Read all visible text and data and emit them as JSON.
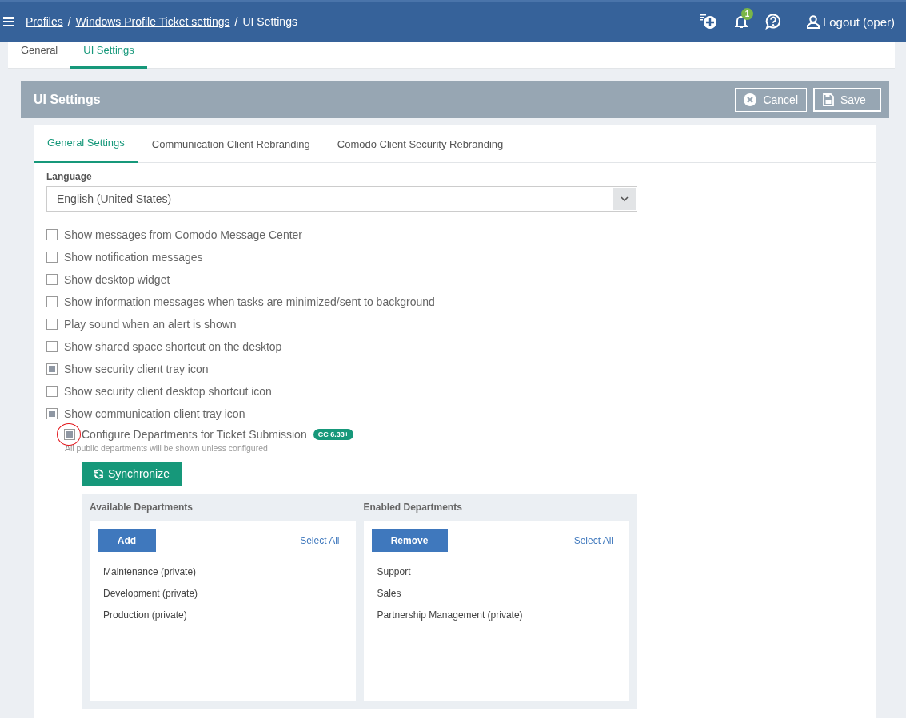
{
  "header": {
    "separator": "/",
    "breadcrumbs": [
      {
        "label": "Profiles",
        "link": true
      },
      {
        "label": "Windows Profile Ticket settings",
        "link": true
      },
      {
        "label": "UI Settings",
        "link": false
      }
    ],
    "notification_count": "1",
    "user": "Logout (oper)"
  },
  "page_tabs": [
    {
      "label": "General",
      "selected": false
    },
    {
      "label": "UI Settings",
      "selected": true
    }
  ],
  "panel": {
    "title": "UI Settings",
    "buttons": [
      {
        "label": "Cancel",
        "kind": "cancel"
      },
      {
        "label": "Save",
        "kind": "save"
      }
    ]
  },
  "tabs": [
    {
      "label": "General Settings",
      "selected": true
    },
    {
      "label": "Communication Client Rebranding",
      "selected": false
    },
    {
      "label": "Comodo Client Security Rebranding",
      "selected": false
    }
  ],
  "language": {
    "label": "Language",
    "value": "English (United States)"
  },
  "options": [
    {
      "label": "Show messages from Comodo Message Center",
      "checked": false
    },
    {
      "label": "Show notification messages",
      "checked": false
    },
    {
      "label": "Show desktop widget",
      "checked": false
    },
    {
      "label": "Show information messages when tasks are minimized/sent to background",
      "checked": false
    },
    {
      "label": "Play sound when an alert is shown",
      "checked": false
    },
    {
      "label": "Show shared space shortcut on the desktop",
      "checked": false
    },
    {
      "label": "Show security client tray icon",
      "checked": true
    },
    {
      "label": "Show security client desktop shortcut icon",
      "checked": false
    },
    {
      "label": "Show communication client tray icon",
      "checked": true,
      "children": [
        {
          "label": "Configure Departments for Ticket Submission",
          "checked": true,
          "highlighted": true,
          "badge": "CC 6.33+",
          "hint": "All public departments will be shown unless configured"
        }
      ]
    }
  ],
  "sync_button": "Synchronize",
  "departments": [
    {
      "title": "Available Departments",
      "action": "Add",
      "select_all": "Select All",
      "items": [
        "Maintenance (private)",
        "Development (private)",
        "Production (private)"
      ]
    },
    {
      "title": "Enabled Departments",
      "action": "Remove",
      "select_all": "Select All",
      "items": [
        "Support",
        "Sales",
        "Partnership Management (private)"
      ]
    }
  ]
}
